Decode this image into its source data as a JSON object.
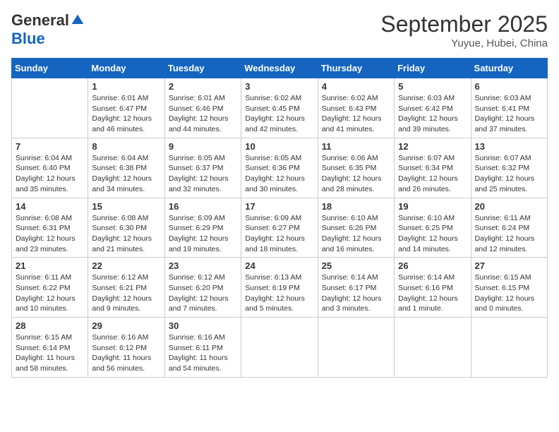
{
  "header": {
    "logo_general": "General",
    "logo_blue": "Blue",
    "month_title": "September 2025",
    "subtitle": "Yuyue, Hubei, China"
  },
  "days_of_week": [
    "Sunday",
    "Monday",
    "Tuesday",
    "Wednesday",
    "Thursday",
    "Friday",
    "Saturday"
  ],
  "weeks": [
    [
      {
        "day": "",
        "info": ""
      },
      {
        "day": "1",
        "info": "Sunrise: 6:01 AM\nSunset: 6:47 PM\nDaylight: 12 hours\nand 46 minutes."
      },
      {
        "day": "2",
        "info": "Sunrise: 6:01 AM\nSunset: 6:46 PM\nDaylight: 12 hours\nand 44 minutes."
      },
      {
        "day": "3",
        "info": "Sunrise: 6:02 AM\nSunset: 6:45 PM\nDaylight: 12 hours\nand 42 minutes."
      },
      {
        "day": "4",
        "info": "Sunrise: 6:02 AM\nSunset: 6:43 PM\nDaylight: 12 hours\nand 41 minutes."
      },
      {
        "day": "5",
        "info": "Sunrise: 6:03 AM\nSunset: 6:42 PM\nDaylight: 12 hours\nand 39 minutes."
      },
      {
        "day": "6",
        "info": "Sunrise: 6:03 AM\nSunset: 6:41 PM\nDaylight: 12 hours\nand 37 minutes."
      }
    ],
    [
      {
        "day": "7",
        "info": "Sunrise: 6:04 AM\nSunset: 6:40 PM\nDaylight: 12 hours\nand 35 minutes."
      },
      {
        "day": "8",
        "info": "Sunrise: 6:04 AM\nSunset: 6:38 PM\nDaylight: 12 hours\nand 34 minutes."
      },
      {
        "day": "9",
        "info": "Sunrise: 6:05 AM\nSunset: 6:37 PM\nDaylight: 12 hours\nand 32 minutes."
      },
      {
        "day": "10",
        "info": "Sunrise: 6:05 AM\nSunset: 6:36 PM\nDaylight: 12 hours\nand 30 minutes."
      },
      {
        "day": "11",
        "info": "Sunrise: 6:06 AM\nSunset: 6:35 PM\nDaylight: 12 hours\nand 28 minutes."
      },
      {
        "day": "12",
        "info": "Sunrise: 6:07 AM\nSunset: 6:34 PM\nDaylight: 12 hours\nand 26 minutes."
      },
      {
        "day": "13",
        "info": "Sunrise: 6:07 AM\nSunset: 6:32 PM\nDaylight: 12 hours\nand 25 minutes."
      }
    ],
    [
      {
        "day": "14",
        "info": "Sunrise: 6:08 AM\nSunset: 6:31 PM\nDaylight: 12 hours\nand 23 minutes."
      },
      {
        "day": "15",
        "info": "Sunrise: 6:08 AM\nSunset: 6:30 PM\nDaylight: 12 hours\nand 21 minutes."
      },
      {
        "day": "16",
        "info": "Sunrise: 6:09 AM\nSunset: 6:29 PM\nDaylight: 12 hours\nand 19 minutes."
      },
      {
        "day": "17",
        "info": "Sunrise: 6:09 AM\nSunset: 6:27 PM\nDaylight: 12 hours\nand 18 minutes."
      },
      {
        "day": "18",
        "info": "Sunrise: 6:10 AM\nSunset: 6:26 PM\nDaylight: 12 hours\nand 16 minutes."
      },
      {
        "day": "19",
        "info": "Sunrise: 6:10 AM\nSunset: 6:25 PM\nDaylight: 12 hours\nand 14 minutes."
      },
      {
        "day": "20",
        "info": "Sunrise: 6:11 AM\nSunset: 6:24 PM\nDaylight: 12 hours\nand 12 minutes."
      }
    ],
    [
      {
        "day": "21",
        "info": "Sunrise: 6:11 AM\nSunset: 6:22 PM\nDaylight: 12 hours\nand 10 minutes."
      },
      {
        "day": "22",
        "info": "Sunrise: 6:12 AM\nSunset: 6:21 PM\nDaylight: 12 hours\nand 9 minutes."
      },
      {
        "day": "23",
        "info": "Sunrise: 6:12 AM\nSunset: 6:20 PM\nDaylight: 12 hours\nand 7 minutes."
      },
      {
        "day": "24",
        "info": "Sunrise: 6:13 AM\nSunset: 6:19 PM\nDaylight: 12 hours\nand 5 minutes."
      },
      {
        "day": "25",
        "info": "Sunrise: 6:14 AM\nSunset: 6:17 PM\nDaylight: 12 hours\nand 3 minutes."
      },
      {
        "day": "26",
        "info": "Sunrise: 6:14 AM\nSunset: 6:16 PM\nDaylight: 12 hours\nand 1 minute."
      },
      {
        "day": "27",
        "info": "Sunrise: 6:15 AM\nSunset: 6:15 PM\nDaylight: 12 hours\nand 0 minutes."
      }
    ],
    [
      {
        "day": "28",
        "info": "Sunrise: 6:15 AM\nSunset: 6:14 PM\nDaylight: 11 hours\nand 58 minutes."
      },
      {
        "day": "29",
        "info": "Sunrise: 6:16 AM\nSunset: 6:12 PM\nDaylight: 11 hours\nand 56 minutes."
      },
      {
        "day": "30",
        "info": "Sunrise: 6:16 AM\nSunset: 6:11 PM\nDaylight: 11 hours\nand 54 minutes."
      },
      {
        "day": "",
        "info": ""
      },
      {
        "day": "",
        "info": ""
      },
      {
        "day": "",
        "info": ""
      },
      {
        "day": "",
        "info": ""
      }
    ]
  ]
}
